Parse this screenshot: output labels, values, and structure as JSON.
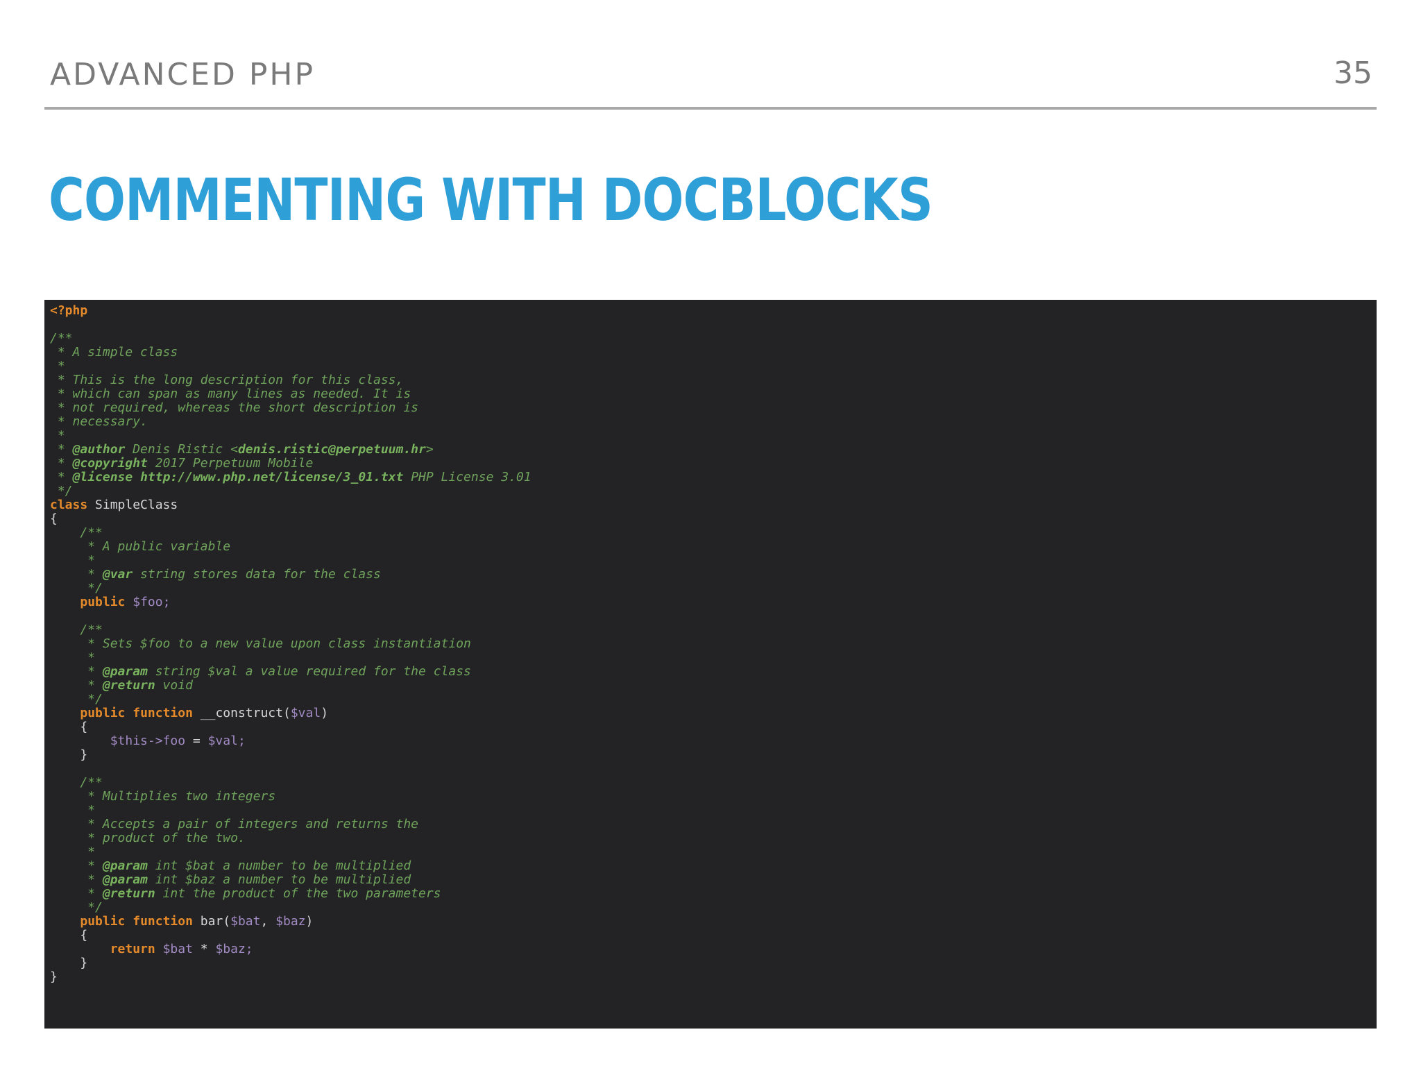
{
  "header": {
    "title": "ADVANCED PHP",
    "page_number": "35"
  },
  "slide": {
    "title": "COMMENTING WITH DOCBLOCKS"
  },
  "code": {
    "language": "php",
    "lines": [
      [
        {
          "t": "php",
          "s": "<?php"
        }
      ],
      [],
      [
        {
          "t": "cm",
          "s": "/**"
        }
      ],
      [
        {
          "t": "cm",
          "s": " * A simple class"
        }
      ],
      [
        {
          "t": "cm",
          "s": " *"
        }
      ],
      [
        {
          "t": "cm",
          "s": " * This is the long description for this class,"
        }
      ],
      [
        {
          "t": "cm",
          "s": " * which can span as many lines as needed. It is"
        }
      ],
      [
        {
          "t": "cm",
          "s": " * not required, whereas the short description is"
        }
      ],
      [
        {
          "t": "cm",
          "s": " * necessary."
        }
      ],
      [
        {
          "t": "cm",
          "s": " *"
        }
      ],
      [
        {
          "t": "cm",
          "s": " * "
        },
        {
          "t": "tag",
          "s": "@author"
        },
        {
          "t": "cm",
          "s": " Denis Ristic <"
        },
        {
          "t": "tag",
          "s": "denis.ristic@perpetuum.hr"
        },
        {
          "t": "cm",
          "s": ">"
        }
      ],
      [
        {
          "t": "cm",
          "s": " * "
        },
        {
          "t": "tag",
          "s": "@copyright"
        },
        {
          "t": "cm",
          "s": " 2017 Perpetuum Mobile"
        }
      ],
      [
        {
          "t": "cm",
          "s": " * "
        },
        {
          "t": "tag",
          "s": "@license"
        },
        {
          "t": "cm",
          "s": " "
        },
        {
          "t": "tag",
          "s": "http://www.php.net/license/3_01.txt"
        },
        {
          "t": "cm",
          "s": " PHP License 3.01"
        }
      ],
      [
        {
          "t": "cm",
          "s": " */"
        }
      ],
      [
        {
          "t": "kw",
          "s": "class"
        },
        {
          "t": "plain",
          "s": " SimpleClass"
        }
      ],
      [
        {
          "t": "plain",
          "s": "{"
        }
      ],
      [
        {
          "t": "cm",
          "s": "    /**"
        }
      ],
      [
        {
          "t": "cm",
          "s": "     * A public variable"
        }
      ],
      [
        {
          "t": "cm",
          "s": "     *"
        }
      ],
      [
        {
          "t": "cm",
          "s": "     * "
        },
        {
          "t": "tag",
          "s": "@var"
        },
        {
          "t": "cm",
          "s": " string stores data for the class"
        }
      ],
      [
        {
          "t": "cm",
          "s": "     */"
        }
      ],
      [
        {
          "t": "plain",
          "s": "    "
        },
        {
          "t": "kw",
          "s": "public"
        },
        {
          "t": "plain",
          "s": " "
        },
        {
          "t": "var",
          "s": "$foo;"
        }
      ],
      [],
      [
        {
          "t": "cm",
          "s": "    /**"
        }
      ],
      [
        {
          "t": "cm",
          "s": "     * Sets $foo to a new value upon class instantiation"
        }
      ],
      [
        {
          "t": "cm",
          "s": "     *"
        }
      ],
      [
        {
          "t": "cm",
          "s": "     * "
        },
        {
          "t": "tag",
          "s": "@param"
        },
        {
          "t": "cm",
          "s": " string $val a value required for the class"
        }
      ],
      [
        {
          "t": "cm",
          "s": "     * "
        },
        {
          "t": "tag",
          "s": "@return"
        },
        {
          "t": "cm",
          "s": " void"
        }
      ],
      [
        {
          "t": "cm",
          "s": "     */"
        }
      ],
      [
        {
          "t": "plain",
          "s": "    "
        },
        {
          "t": "kw",
          "s": "public"
        },
        {
          "t": "plain",
          "s": " "
        },
        {
          "t": "kw",
          "s": "function"
        },
        {
          "t": "plain",
          "s": " __construct("
        },
        {
          "t": "var",
          "s": "$val"
        },
        {
          "t": "plain",
          "s": ")"
        }
      ],
      [
        {
          "t": "plain",
          "s": "    {"
        }
      ],
      [
        {
          "t": "plain",
          "s": "        "
        },
        {
          "t": "var",
          "s": "$this->foo"
        },
        {
          "t": "plain",
          "s": " = "
        },
        {
          "t": "var",
          "s": "$val;"
        }
      ],
      [
        {
          "t": "plain",
          "s": "    }"
        }
      ],
      [],
      [
        {
          "t": "cm",
          "s": "    /**"
        }
      ],
      [
        {
          "t": "cm",
          "s": "     * Multiplies two integers"
        }
      ],
      [
        {
          "t": "cm",
          "s": "     *"
        }
      ],
      [
        {
          "t": "cm",
          "s": "     * Accepts a pair of integers and returns the"
        }
      ],
      [
        {
          "t": "cm",
          "s": "     * product of the two."
        }
      ],
      [
        {
          "t": "cm",
          "s": "     *"
        }
      ],
      [
        {
          "t": "cm",
          "s": "     * "
        },
        {
          "t": "tag",
          "s": "@param"
        },
        {
          "t": "cm",
          "s": " int $bat a number to be multiplied"
        }
      ],
      [
        {
          "t": "cm",
          "s": "     * "
        },
        {
          "t": "tag",
          "s": "@param"
        },
        {
          "t": "cm",
          "s": " int $baz a number to be multiplied"
        }
      ],
      [
        {
          "t": "cm",
          "s": "     * "
        },
        {
          "t": "tag",
          "s": "@return"
        },
        {
          "t": "cm",
          "s": " int the product of the two parameters"
        }
      ],
      [
        {
          "t": "cm",
          "s": "     */"
        }
      ],
      [
        {
          "t": "plain",
          "s": "    "
        },
        {
          "t": "kw",
          "s": "public"
        },
        {
          "t": "plain",
          "s": " "
        },
        {
          "t": "kw",
          "s": "function"
        },
        {
          "t": "plain",
          "s": " bar("
        },
        {
          "t": "var",
          "s": "$bat"
        },
        {
          "t": "plain",
          "s": ", "
        },
        {
          "t": "var",
          "s": "$baz"
        },
        {
          "t": "plain",
          "s": ")"
        }
      ],
      [
        {
          "t": "plain",
          "s": "    {"
        }
      ],
      [
        {
          "t": "plain",
          "s": "        "
        },
        {
          "t": "kw",
          "s": "return"
        },
        {
          "t": "plain",
          "s": " "
        },
        {
          "t": "var",
          "s": "$bat"
        },
        {
          "t": "plain",
          "s": " * "
        },
        {
          "t": "var",
          "s": "$baz;"
        }
      ],
      [
        {
          "t": "plain",
          "s": "    }"
        }
      ],
      [
        {
          "t": "plain",
          "s": "}"
        }
      ]
    ]
  },
  "colors": {
    "title_accent": "#2f9fd8",
    "header_gray": "#7a7a7a",
    "code_background": "#232325",
    "comment": "#6fa35b",
    "keyword": "#e58a2b",
    "variable": "#a28bc4",
    "plain": "#d6d6d6"
  }
}
